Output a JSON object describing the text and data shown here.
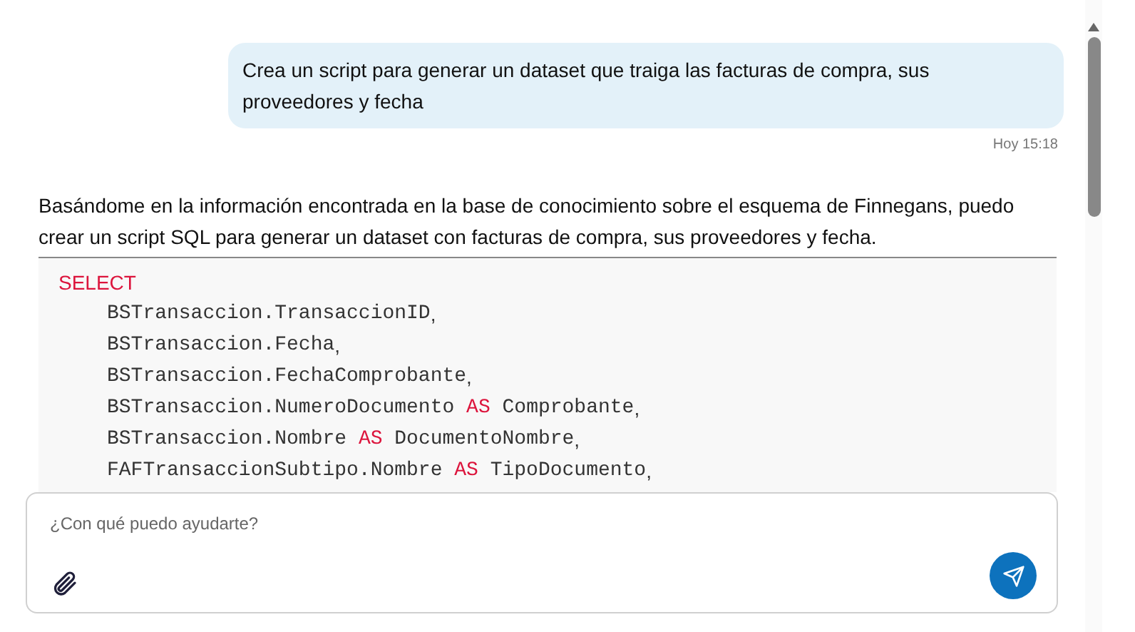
{
  "user_message": {
    "text": "Crea un script para generar un dataset que traiga las facturas de compra, sus proveedores y fecha",
    "time": "Hoy 15:18"
  },
  "assistant_message": {
    "text": "Basándome en la información encontrada en la base de conocimiento sobre el esquema de Finnegans, puedo crear un script SQL para generar un dataset con facturas de compra, sus proveedores y fecha."
  },
  "code_block": {
    "lines": [
      {
        "kind": "clause",
        "segments": [
          {
            "kind": "keyword",
            "text": "SELECT"
          }
        ]
      },
      {
        "kind": "column",
        "segments": [
          {
            "kind": "ident",
            "text": "BSTransaccion.TransaccionID"
          },
          {
            "kind": "punct",
            "text": ","
          }
        ]
      },
      {
        "kind": "column",
        "segments": [
          {
            "kind": "ident",
            "text": "BSTransaccion.Fecha"
          },
          {
            "kind": "punct",
            "text": ","
          }
        ]
      },
      {
        "kind": "column",
        "segments": [
          {
            "kind": "ident",
            "text": "BSTransaccion.FechaComprobante"
          },
          {
            "kind": "punct",
            "text": ","
          }
        ]
      },
      {
        "kind": "column",
        "segments": [
          {
            "kind": "ident",
            "text": "BSTransaccion.NumeroDocumento "
          },
          {
            "kind": "keyword",
            "text": "AS"
          },
          {
            "kind": "ident",
            "text": " Comprobante"
          },
          {
            "kind": "punct",
            "text": ","
          }
        ]
      },
      {
        "kind": "column",
        "segments": [
          {
            "kind": "ident",
            "text": "BSTransaccion.Nombre "
          },
          {
            "kind": "keyword",
            "text": "AS"
          },
          {
            "kind": "ident",
            "text": " DocumentoNombre"
          },
          {
            "kind": "punct",
            "text": ","
          }
        ]
      },
      {
        "kind": "column",
        "segments": [
          {
            "kind": "ident",
            "text": "FAFTransaccionSubtipo.Nombre "
          },
          {
            "kind": "keyword",
            "text": "AS"
          },
          {
            "kind": "ident",
            "text": " TipoDocumento"
          },
          {
            "kind": "punct",
            "text": ","
          }
        ]
      }
    ]
  },
  "composer": {
    "placeholder": "¿Con qué puedo ayudarte?"
  }
}
